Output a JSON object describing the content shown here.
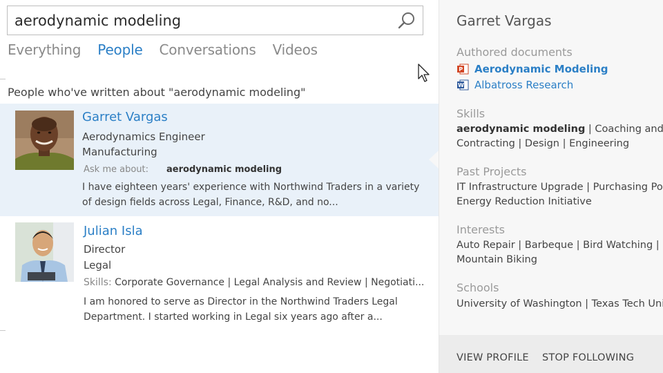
{
  "search": {
    "value": "aerodynamic modeling",
    "placeholder": ""
  },
  "tabs": [
    {
      "label": "Everything",
      "active": false
    },
    {
      "label": "People",
      "active": true
    },
    {
      "label": "Conversations",
      "active": false
    },
    {
      "label": "Videos",
      "active": false
    }
  ],
  "results_heading": "People who've written about \"aerodynamic modeling\"",
  "results": [
    {
      "name": "Garret Vargas",
      "title": "Aerodynamics Engineer",
      "department": "Manufacturing",
      "ask_label": "Ask me about:",
      "ask_value": "aerodynamic modeling",
      "description": "I have eighteen years' experience with Northwind Traders in a variety of design fields across Legal, Finance, R&D, and no..."
    },
    {
      "name": "Julian Isla",
      "title": "Director",
      "department": "Legal",
      "skills_label": "Skills:",
      "skills_value": "Corporate Governance | Legal Analysis and Review | Negotiati...",
      "description": "I am honored to serve as Director in the Northwind Traders Legal Department. I started working in Legal six years ago after a..."
    }
  ],
  "profile": {
    "name": "Garret Vargas",
    "authored_label": "Authored documents",
    "documents": [
      {
        "title": "Aerodynamic Modeling",
        "icon": "powerpoint-icon"
      },
      {
        "title": "Albatross Research",
        "icon": "word-icon"
      }
    ],
    "skills_label": "Skills",
    "skills_bold": "aerodynamic modeling",
    "skills_rest": " | Coaching and M",
    "skills_line2": "Contracting | Design | Engineering",
    "projects_label": "Past Projects",
    "projects_line1": "IT Infrastructure Upgrade | Purchasing Port",
    "projects_line2": "Energy Reduction Initiative",
    "interests_label": "Interests",
    "interests_line1": "Auto Repair | Barbeque | Bird Watching | Cl",
    "interests_line2": "Mountain Biking",
    "schools_label": "Schools",
    "schools_line1": "University of Washington | Texas Tech Univer",
    "view_profile": "VIEW PROFILE",
    "stop_following": "STOP FOLLOWING"
  },
  "colors": {
    "accent": "#2b7fc6",
    "selected_bg": "#e9f1f9",
    "panel_bg": "#f7f7f7",
    "footer_bg": "#ececec"
  }
}
